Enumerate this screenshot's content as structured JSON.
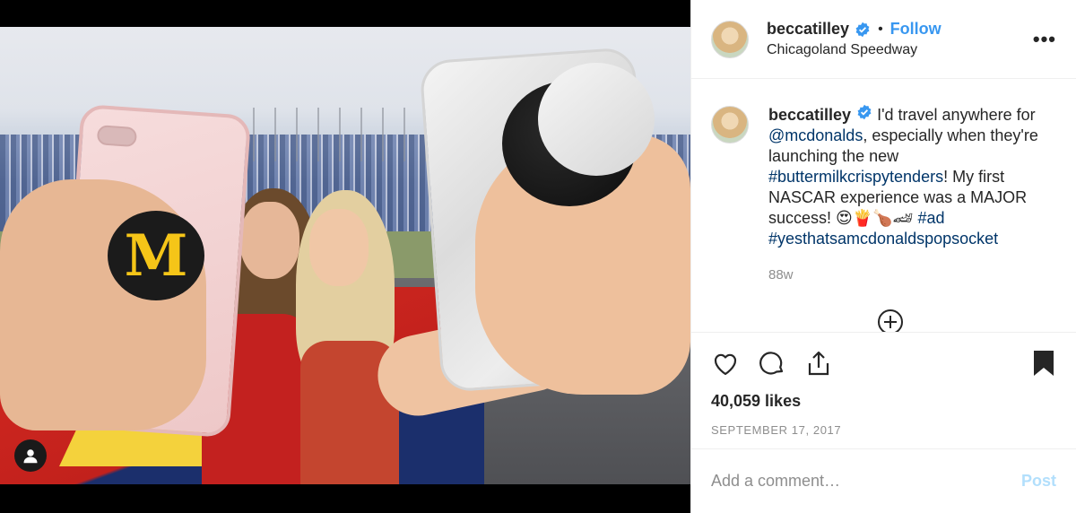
{
  "header": {
    "username": "beccatilley",
    "separator": "•",
    "follow_label": "Follow",
    "location": "Chicagoland Speedway",
    "more_label": "•••"
  },
  "media": {
    "popsocket_logo_text": "M"
  },
  "caption": {
    "username": "beccatilley",
    "text_1": "I'd travel anywhere for",
    "mention": "@mcdonalds",
    "text_2": ", especially when they're launching the new",
    "hashtag_1": "#buttermilkcrispytenders",
    "text_3": "! My first NASCAR experience was a MAJOR success! 😍🍟🍗🏎",
    "hashtag_2": "#ad",
    "hashtag_3": "#yesthatsamcdonaldspopsocket",
    "time": "88w"
  },
  "actions": {
    "likes": "40,059 likes",
    "date": "SEPTEMBER 17, 2017"
  },
  "comment": {
    "placeholder": "Add a comment…",
    "post_label": "Post"
  },
  "colors": {
    "follow": "#3897f0",
    "verified": "#3897f0",
    "hashtag": "#003569",
    "post_disabled": "#b2dffc"
  }
}
